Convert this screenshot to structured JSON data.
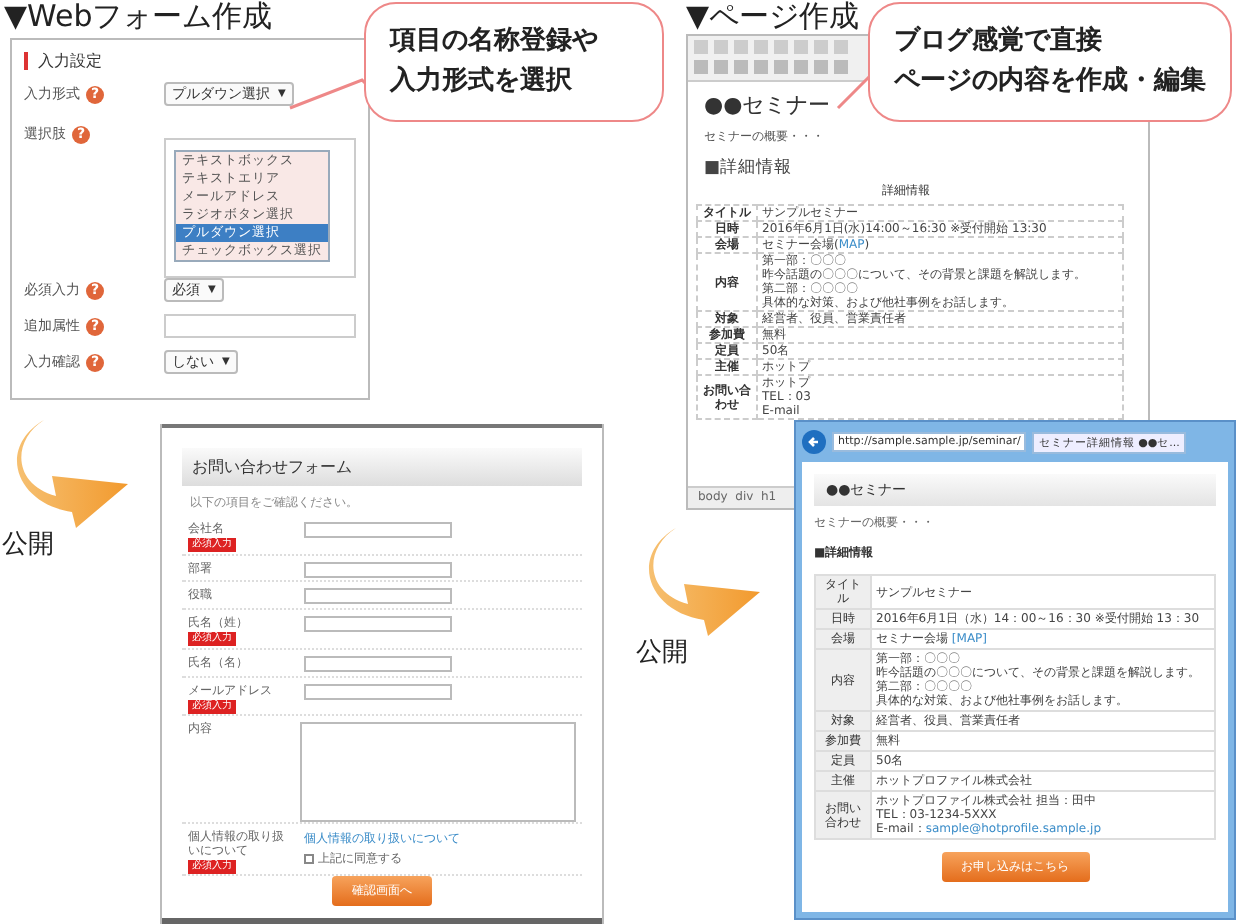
{
  "form_builder": {
    "heading": "▼Webフォーム作成",
    "section": "入力設定",
    "fields": [
      {
        "label": "入力形式",
        "hint": "?",
        "kind": "select",
        "value": "プルダウン選択",
        "caret": "▼"
      },
      {
        "label": "選択肢",
        "hint": "?",
        "kind": "textarea"
      },
      {
        "label": "必須入力",
        "hint": "?",
        "kind": "select",
        "value": "必須",
        "caret": "▼"
      },
      {
        "label": "追加属性",
        "hint": "?",
        "kind": "text"
      },
      {
        "label": "入力確認",
        "hint": "?",
        "kind": "select",
        "value": "しない",
        "caret": "▼"
      }
    ],
    "options": [
      {
        "label": "テキストボックス",
        "selected": false
      },
      {
        "label": "テキストエリア",
        "selected": false
      },
      {
        "label": "メールアドレス",
        "selected": false
      },
      {
        "label": "ラジオボタン選択",
        "selected": false
      },
      {
        "label": "プルダウン選択",
        "selected": true
      },
      {
        "label": "チェックボックス選択",
        "selected": false
      }
    ],
    "callout": [
      "項目の名称登録や",
      "入力形式を選択"
    ]
  },
  "contact_form": {
    "publish_label": "公開",
    "title": "お問い合わせフォーム",
    "intro": "以下の項目をご確認ください。",
    "fields": [
      {
        "label": "会社名",
        "badge": "必須入力",
        "kind": "text"
      },
      {
        "label": "部署",
        "kind": "text"
      },
      {
        "label": "役職",
        "kind": "text"
      },
      {
        "label": "氏名（姓）",
        "badge": "必須入力",
        "kind": "text"
      },
      {
        "label": "氏名（名）",
        "kind": "text"
      },
      {
        "label": "メールアドレス",
        "badge": "必須入力",
        "kind": "text"
      },
      {
        "label": "内容",
        "kind": "textarea"
      },
      {
        "label": "個人情報の取り扱いについて",
        "badge": "必須入力",
        "kind": "consent",
        "link": "個人情報の取り扱いについて",
        "checkbox_label": "上記に同意する",
        "checked": false
      }
    ],
    "button": "確認画面へ"
  },
  "page_editor": {
    "heading": "▼ページ作成",
    "callout": [
      "ブログ感覚で直接",
      "ページの内容を作成・編集"
    ],
    "title": "●●セミナー",
    "summary": "セミナーの概要・・・",
    "section": "■詳細情報",
    "table_caption": "詳細情報",
    "rows": [
      {
        "label": "タイトル",
        "lines": [
          "サンプルセミナー"
        ]
      },
      {
        "label": "日時",
        "lines": [
          "2016年6月1日(水)14:00～16:30 ※受付開始 13:30"
        ]
      },
      {
        "label": "会場",
        "lines": [
          "セミナー会場("
        ],
        "link": "MAP",
        "after": ")"
      },
      {
        "label": "内容",
        "lines": [
          "第一部：〇〇〇",
          "昨今話題の〇〇〇について、その背景と課題を解説します。",
          "第二部：〇〇〇〇",
          "具体的な対策、および他社事例をお話します。"
        ]
      },
      {
        "label": "対象",
        "lines": [
          "経営者、役員、営業責任者"
        ]
      },
      {
        "label": "参加費",
        "lines": [
          "無料"
        ]
      },
      {
        "label": "定員",
        "lines": [
          "50名"
        ]
      },
      {
        "label": "主催",
        "lines": [
          "ホットプ"
        ]
      },
      {
        "label": "お問い合わせ",
        "lines": [
          "ホットプ",
          "TEL：03",
          "E-mail"
        ]
      }
    ],
    "status_bar": "body  div  h1"
  },
  "browser": {
    "publish_label": "公開",
    "address": "http://sample.sample.jp/seminar/",
    "tab": "セミナー詳細情報 ●●セ...",
    "title": "●●セミナー",
    "summary": "セミナーの概要・・・",
    "section": "■詳細情報",
    "rows": [
      {
        "label": "タイトル",
        "lines": [
          "サンプルセミナー"
        ]
      },
      {
        "label": "日時",
        "lines": [
          "2016年6月1日（水）14：00～16：30 ※受付開始 13：30"
        ]
      },
      {
        "label": "会場",
        "lines": [
          "セミナー会場 "
        ],
        "link": "[MAP]"
      },
      {
        "label": "内容",
        "lines": [
          "第一部：〇〇〇",
          "昨今話題の〇〇〇について、その背景と課題を解説します。",
          "第二部：〇〇〇〇",
          "具体的な対策、および他社事例をお話します。"
        ]
      },
      {
        "label": "対象",
        "lines": [
          "経営者、役員、営業責任者"
        ]
      },
      {
        "label": "参加費",
        "lines": [
          "無料"
        ]
      },
      {
        "label": "定員",
        "lines": [
          "50名"
        ]
      },
      {
        "label": "主催",
        "lines": [
          "ホットプロファイル株式会社"
        ]
      },
      {
        "label": "お問い合わせ",
        "lines": [
          "ホットプロファイル株式会社 担当：田中",
          "TEL：03-1234-5XXX"
        ],
        "link_prefix": "E-mail：",
        "link": "sample@hotprofile.sample.jp"
      }
    ],
    "button": "お申し込みはこちら"
  }
}
